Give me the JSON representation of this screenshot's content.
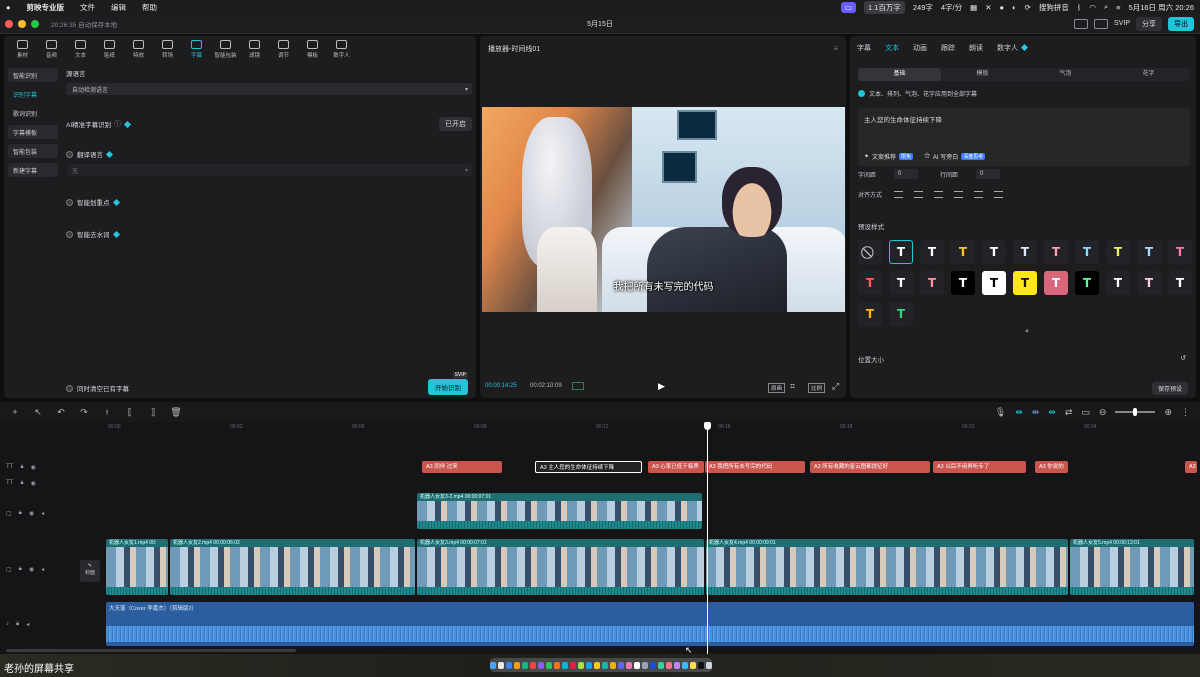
{
  "menubar": {
    "app": "剪映专业版",
    "items": [
      "文件",
      "编辑",
      "帮助"
    ],
    "status": [
      "1.1百万字",
      "249字",
      "4字/分"
    ],
    "ime": "搜狗拼音",
    "datetime": "5月16日 周六 20:26"
  },
  "titlebar": {
    "autosave": "20:26:35 自动保存本地",
    "title": "5月15日",
    "svip": "SVIP",
    "share": "分享",
    "export": "导出"
  },
  "toolbar": {
    "items": [
      "素材",
      "音频",
      "文本",
      "贴纸",
      "特效",
      "转场",
      "字幕",
      "智能包装",
      "滤镜",
      "调节",
      "模板",
      "数字人"
    ],
    "active_index": 6
  },
  "subnav": {
    "items": [
      "智能识别",
      "识别字幕",
      "歌词识别",
      "字幕模板",
      "智能包装",
      "新建字幕"
    ]
  },
  "caption_form": {
    "source_lang_label": "源语言",
    "source_lang_value": "自动检测语言",
    "ai_precise_label": "AI精准字幕识别",
    "ai_precise_state": "已开启",
    "translate_label": "翻译语言",
    "translate_placeholder": "无",
    "highlight_label": "智能划重点",
    "dewater_label": "智能去水词",
    "clear_existing_label": "同时清空已有字幕",
    "start_button": "开始识别",
    "start_badge": "SVIP"
  },
  "player": {
    "title": "播放器-时间线01",
    "subtitle": "我把所有未写完的代码",
    "current_time": "00:00:14:25",
    "total_time": "00:02:10:09",
    "quality": "原画",
    "ratio": "比例"
  },
  "right_panel": {
    "tabs": [
      "字幕",
      "文本",
      "动画",
      "跟踪",
      "朗读",
      "数字人"
    ],
    "active_tab": 1,
    "subtabs": [
      "基础",
      "模板",
      "气泡",
      "花字"
    ],
    "apply_all": "文本、排列、气泡、花字应用到全部字幕",
    "text_value": "主人您的生命体征持续下降",
    "copy_suggest": "文案推荐",
    "ai_write": "AI 写旁白",
    "letter_spacing_label": "字间距",
    "letter_spacing": "0",
    "line_spacing_label": "行间距",
    "line_spacing": "0",
    "align_label": "对齐方式",
    "preset_label": "预设样式",
    "position_label": "位置大小",
    "save_preset": "保存预设"
  },
  "presets": [
    {
      "glyph": "⃠",
      "color": "#bbbbbb",
      "bg": "#232327",
      "selected": false
    },
    {
      "glyph": "T",
      "color": "#ffffff",
      "bg": "#232327",
      "selected": true
    },
    {
      "glyph": "T",
      "color": "#ffffff",
      "bg": "#232327",
      "selected": false
    },
    {
      "glyph": "T",
      "color": "#f5c518",
      "bg": "#232327",
      "selected": false
    },
    {
      "glyph": "T",
      "color": "#ffffff",
      "bg": "#232327",
      "selected": false
    },
    {
      "glyph": "T",
      "color": "#dde6ff",
      "bg": "#232327",
      "selected": false
    },
    {
      "glyph": "T",
      "color": "#ff9fb5",
      "bg": "#232327",
      "selected": false
    },
    {
      "glyph": "T",
      "color": "#7ee0ff",
      "bg": "#232327",
      "selected": false
    },
    {
      "glyph": "T",
      "color": "#e6f06a",
      "bg": "#232327",
      "selected": false
    },
    {
      "glyph": "T",
      "color": "#a8d8ff",
      "bg": "#232327",
      "selected": false
    },
    {
      "glyph": "T",
      "color": "#ff7aa0",
      "bg": "#232327",
      "selected": false
    },
    {
      "glyph": "T",
      "color": "#ff5b5b",
      "bg": "#232327",
      "selected": false
    },
    {
      "glyph": "T",
      "color": "#ffffff",
      "bg": "#232327",
      "selected": false
    },
    {
      "glyph": "T",
      "color": "#ff8fa0",
      "bg": "#232327",
      "selected": false
    },
    {
      "glyph": "T",
      "color": "#ffffff",
      "bg": "#000000",
      "selected": false
    },
    {
      "glyph": "T",
      "color": "#000000",
      "bg": "#ffffff",
      "selected": false
    },
    {
      "glyph": "T",
      "color": "#111111",
      "bg": "#ffe81a",
      "selected": false
    },
    {
      "glyph": "T",
      "color": "#ffffff",
      "bg": "#d9667a",
      "selected": false
    },
    {
      "glyph": "T",
      "color": "#5bffa0",
      "bg": "#000000",
      "selected": false
    },
    {
      "glyph": "T",
      "color": "#ffffff",
      "bg": "#232327",
      "selected": false
    },
    {
      "glyph": "T",
      "color": "#ffd0e0",
      "bg": "#232327",
      "selected": false
    },
    {
      "glyph": "T",
      "color": "#ffffff",
      "bg": "#232327",
      "selected": false
    },
    {
      "glyph": "T",
      "color": "#ffb21a",
      "bg": "#232327",
      "selected": false
    },
    {
      "glyph": "T",
      "color": "#3ad07a",
      "bg": "#232327",
      "selected": false
    }
  ],
  "timeline": {
    "ruler": [
      "00:00",
      "00:03",
      "00:06",
      "00:09",
      "00:12",
      "00:15",
      "00:18",
      "00:21",
      "00:24"
    ],
    "captions": [
      {
        "text": "A3 同伴 过来",
        "selected": false
      },
      {
        "text": "A3 主人您的生命体征持续下降",
        "selected": true
      },
      {
        "text": "A3 心率已低于临界",
        "selected": false
      },
      {
        "text": "A3 我把所有未写完的代码",
        "selected": false
      },
      {
        "text": "A3 所有收藏的星云图都提征好",
        "selected": false
      },
      {
        "text": "A3 以后不用再听专了",
        "selected": false
      },
      {
        "text": "A3 你说的",
        "selected": false
      },
      {
        "text": "A3",
        "selected": false
      }
    ],
    "overlay_clip": "机器人女友3-2.mp4  00:00:07:01",
    "main_clips": [
      "机器人女友1.mp4  00:",
      "机器人女友2.mp4  00:00:06:03",
      "机器人女友3.mp4  00:00:07:01",
      "机器人女友4.mp4  00:00:09:01",
      "机器人女友5.mp4  00:00:13:01"
    ],
    "cover_label": "封面",
    "audio_label": "大天蓬（Cover 李嘉杰）（剪辑版2）"
  },
  "footer": {
    "share_label": "老孙的屏幕共享"
  }
}
